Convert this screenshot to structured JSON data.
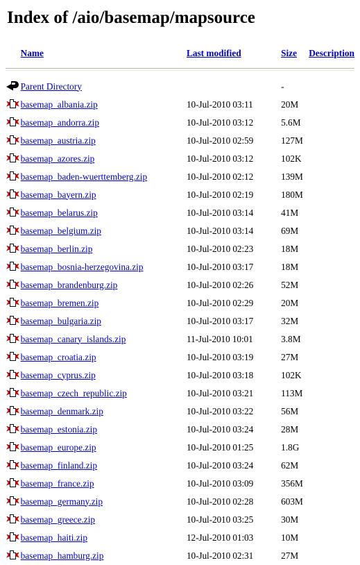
{
  "page": {
    "title": "Index of /aio/basemap/mapsource"
  },
  "table": {
    "headers": [
      {
        "label": "Name",
        "name": "name"
      },
      {
        "label": "Last modified",
        "name": "last-modified"
      },
      {
        "label": "Size",
        "name": "size"
      },
      {
        "label": "Description",
        "name": "description"
      }
    ],
    "parent": {
      "icon": "back-icon",
      "label": "Parent Directory",
      "last_modified": "",
      "size": "-",
      "description": ""
    },
    "rows": [
      {
        "icon": "compressed-icon",
        "name": "basemap_albania.zip",
        "last_modified": "10-Jul-2010 03:11",
        "size": "20M",
        "description": ""
      },
      {
        "icon": "compressed-icon",
        "name": "basemap_andorra.zip",
        "last_modified": "10-Jul-2010 03:12",
        "size": "5.6M",
        "description": ""
      },
      {
        "icon": "compressed-icon",
        "name": "basemap_austria.zip",
        "last_modified": "10-Jul-2010 02:59",
        "size": "127M",
        "description": ""
      },
      {
        "icon": "compressed-icon",
        "name": "basemap_azores.zip",
        "last_modified": "10-Jul-2010 03:12",
        "size": "102K",
        "description": ""
      },
      {
        "icon": "compressed-icon",
        "name": "basemap_baden-wuerttemberg.zip",
        "last_modified": "10-Jul-2010 02:12",
        "size": "139M",
        "description": ""
      },
      {
        "icon": "compressed-icon",
        "name": "basemap_bayern.zip",
        "last_modified": "10-Jul-2010 02:19",
        "size": "180M",
        "description": ""
      },
      {
        "icon": "compressed-icon",
        "name": "basemap_belarus.zip",
        "last_modified": "10-Jul-2010 03:14",
        "size": "41M",
        "description": ""
      },
      {
        "icon": "compressed-icon",
        "name": "basemap_belgium.zip",
        "last_modified": "10-Jul-2010 03:14",
        "size": "69M",
        "description": ""
      },
      {
        "icon": "compressed-icon",
        "name": "basemap_berlin.zip",
        "last_modified": "10-Jul-2010 02:23",
        "size": "18M",
        "description": ""
      },
      {
        "icon": "compressed-icon",
        "name": "basemap_bosnia-herzegovina.zip",
        "last_modified": "10-Jul-2010 03:17",
        "size": "18M",
        "description": ""
      },
      {
        "icon": "compressed-icon",
        "name": "basemap_brandenburg.zip",
        "last_modified": "10-Jul-2010 02:26",
        "size": "52M",
        "description": ""
      },
      {
        "icon": "compressed-icon",
        "name": "basemap_bremen.zip",
        "last_modified": "10-Jul-2010 02:29",
        "size": "20M",
        "description": ""
      },
      {
        "icon": "compressed-icon",
        "name": "basemap_bulgaria.zip",
        "last_modified": "10-Jul-2010 03:17",
        "size": "32M",
        "description": ""
      },
      {
        "icon": "compressed-icon",
        "name": "basemap_canary_islands.zip",
        "last_modified": "11-Jul-2010 10:01",
        "size": "3.8M",
        "description": ""
      },
      {
        "icon": "compressed-icon",
        "name": "basemap_croatia.zip",
        "last_modified": "10-Jul-2010 03:19",
        "size": "27M",
        "description": ""
      },
      {
        "icon": "compressed-icon",
        "name": "basemap_cyprus.zip",
        "last_modified": "10-Jul-2010 03:18",
        "size": "102K",
        "description": ""
      },
      {
        "icon": "compressed-icon",
        "name": "basemap_czech_republic.zip",
        "last_modified": "10-Jul-2010 03:21",
        "size": "113M",
        "description": ""
      },
      {
        "icon": "compressed-icon",
        "name": "basemap_denmark.zip",
        "last_modified": "10-Jul-2010 03:22",
        "size": "56M",
        "description": ""
      },
      {
        "icon": "compressed-icon",
        "name": "basemap_estonia.zip",
        "last_modified": "10-Jul-2010 03:24",
        "size": "28M",
        "description": ""
      },
      {
        "icon": "compressed-icon",
        "name": "basemap_europe.zip",
        "last_modified": "10-Jul-2010 01:25",
        "size": "1.8G",
        "description": ""
      },
      {
        "icon": "compressed-icon",
        "name": "basemap_finland.zip",
        "last_modified": "10-Jul-2010 03:24",
        "size": "62M",
        "description": ""
      },
      {
        "icon": "compressed-icon",
        "name": "basemap_france.zip",
        "last_modified": "10-Jul-2010 03:09",
        "size": "356M",
        "description": ""
      },
      {
        "icon": "compressed-icon",
        "name": "basemap_germany.zip",
        "last_modified": "10-Jul-2010 02:28",
        "size": "603M",
        "description": ""
      },
      {
        "icon": "compressed-icon",
        "name": "basemap_greece.zip",
        "last_modified": "10-Jul-2010 03:25",
        "size": "30M",
        "description": ""
      },
      {
        "icon": "compressed-icon",
        "name": "basemap_haiti.zip",
        "last_modified": "12-Jul-2010 01:03",
        "size": "10M",
        "description": ""
      },
      {
        "icon": "compressed-icon",
        "name": "basemap_hamburg.zip",
        "last_modified": "10-Jul-2010 02:31",
        "size": "27M",
        "description": ""
      }
    ]
  },
  "colors": {
    "link": "#0000cc",
    "text": "#000000",
    "background": "#ffffff",
    "rule": "#b9b9ac",
    "icon_red": "#cc0000"
  }
}
